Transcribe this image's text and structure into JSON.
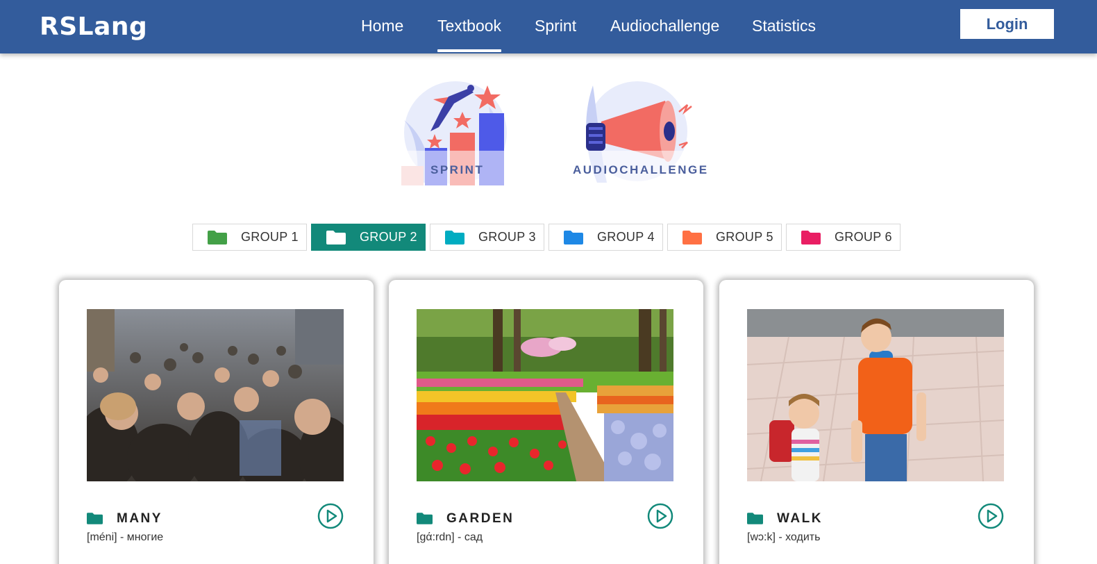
{
  "header": {
    "logo": "RSLang",
    "nav": [
      {
        "label": "Home"
      },
      {
        "label": "Textbook",
        "active": true
      },
      {
        "label": "Sprint"
      },
      {
        "label": "Audiochallenge"
      },
      {
        "label": "Statistics"
      }
    ],
    "login_label": "Login"
  },
  "games": {
    "sprint_label": "SPRINT",
    "audio_label": "AUDIOCHALLENGE"
  },
  "groups": [
    {
      "label": "GROUP 1",
      "color": "#43a047"
    },
    {
      "label": "GROUP 2",
      "color": "#12897a",
      "active": true
    },
    {
      "label": "GROUP 3",
      "color": "#00acc1"
    },
    {
      "label": "GROUP 4",
      "color": "#1e88e5"
    },
    {
      "label": "GROUP 5",
      "color": "#ff7043"
    },
    {
      "label": "GROUP 6",
      "color": "#e91e63"
    }
  ],
  "cards": [
    {
      "word": "MANY",
      "transcription": "[méni] - многие",
      "icon": "play-icon"
    },
    {
      "word": "GARDEN",
      "transcription": "[gά:rdn] - сад",
      "icon": "play-icon"
    },
    {
      "word": "WALK",
      "transcription": "[wɔ:k] - ходить",
      "icon": "play-icon"
    }
  ],
  "colors": {
    "header_bg": "#335c9c",
    "accent": "#12897a"
  }
}
